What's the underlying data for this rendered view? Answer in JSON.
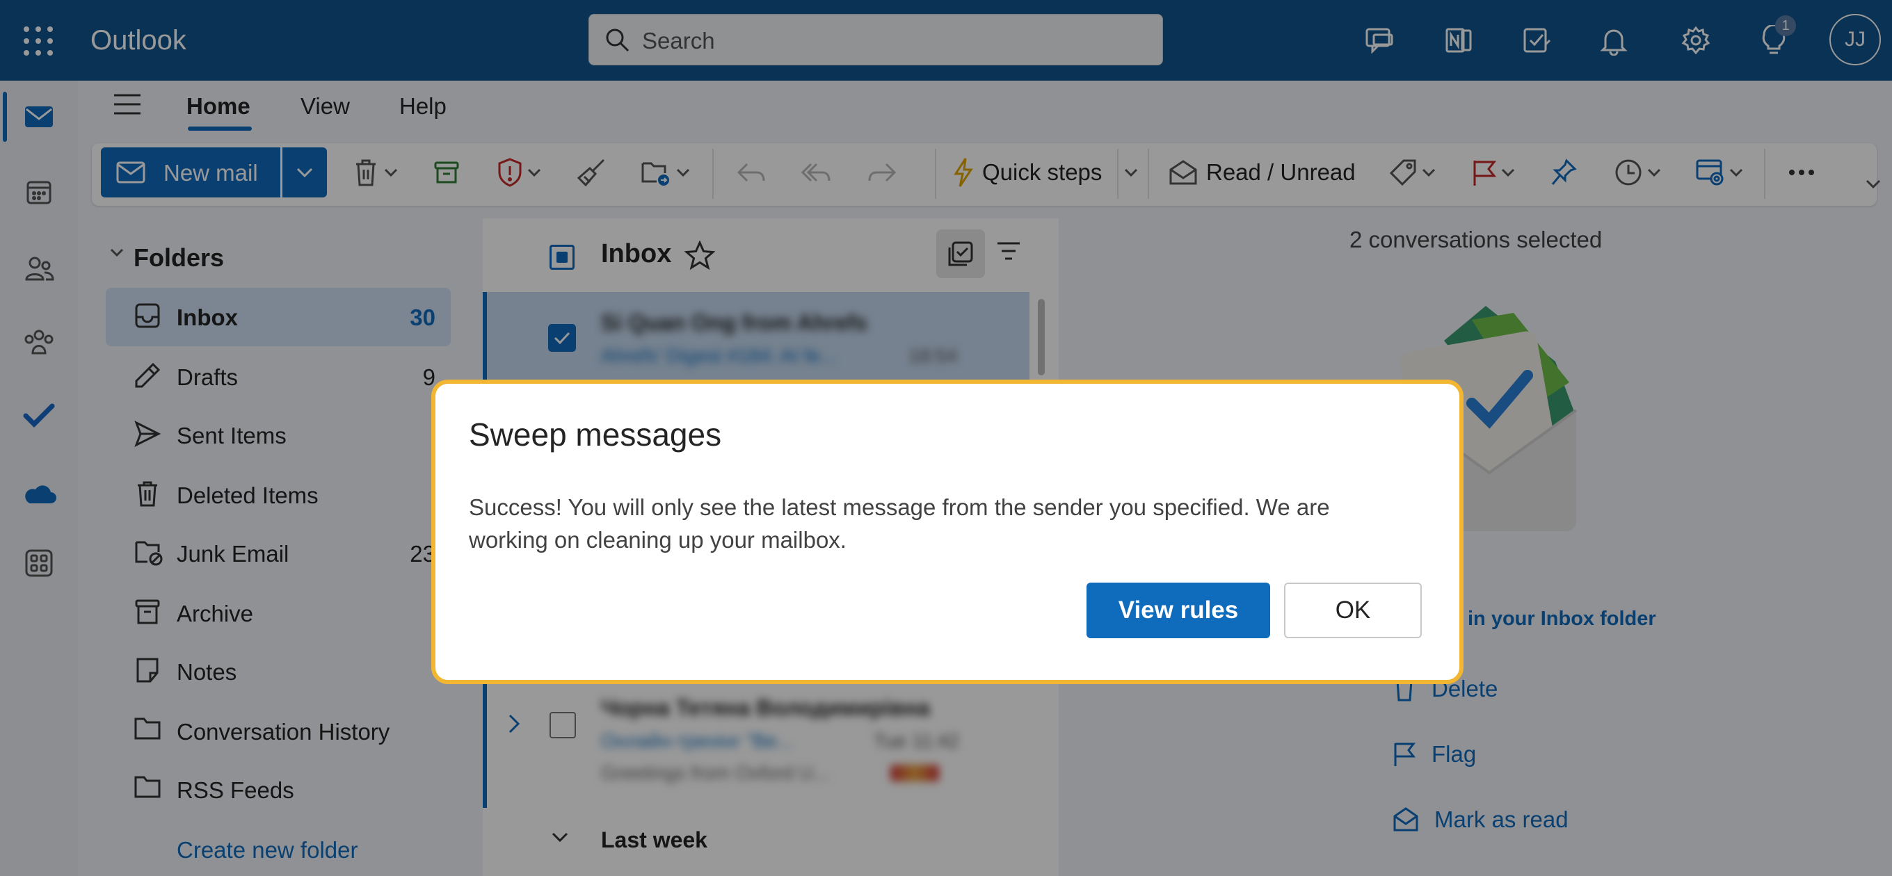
{
  "app": {
    "name": "Outlook"
  },
  "search": {
    "placeholder": "Search"
  },
  "topbar": {
    "tips_badge": "1",
    "avatar_initials": "JJ"
  },
  "menu_tabs": [
    "Home",
    "View",
    "Help"
  ],
  "ribbon": {
    "new_mail": "New mail",
    "quick_steps": "Quick steps",
    "read_unread": "Read / Unread"
  },
  "folders": {
    "header": "Folders",
    "items": [
      {
        "name": "Inbox",
        "count": "30"
      },
      {
        "name": "Drafts",
        "count": "9"
      },
      {
        "name": "Sent Items",
        "count": ""
      },
      {
        "name": "Deleted Items",
        "count": ""
      },
      {
        "name": "Junk Email",
        "count": "23"
      },
      {
        "name": "Archive",
        "count": ""
      },
      {
        "name": "Notes",
        "count": ""
      },
      {
        "name": "Conversation History",
        "count": ""
      },
      {
        "name": "RSS Feeds",
        "count": ""
      }
    ],
    "create": "Create new folder"
  },
  "message_list": {
    "title": "Inbox",
    "group_last_week": "Last week",
    "msg1": {
      "from": "Si Quan Ong from Ahrefs",
      "subject": "Ahrefs' Digest #184: AI fe...",
      "time": "18:54"
    },
    "msg2": {
      "from": "Чорна Тетяна Володимирівна",
      "subject": "Онлайн-тренінг \"Ве...",
      "time": "Tue 11:42",
      "preview": "Greetings from Oxford U..."
    }
  },
  "reading_pane": {
    "selected": "2 conversations selected",
    "inbox_link": "in your Inbox folder",
    "actions": [
      "Delete",
      "Flag",
      "Mark as read"
    ]
  },
  "dialog": {
    "title": "Sweep messages",
    "message": "Success! You will only see the latest message from the sender you specified. We are working on cleaning up your mailbox.",
    "primary": "View rules",
    "secondary": "OK"
  },
  "colors": {
    "brand": "#0f548c",
    "accent": "#0f6cbd",
    "dialog_highlight": "#f2b632"
  }
}
